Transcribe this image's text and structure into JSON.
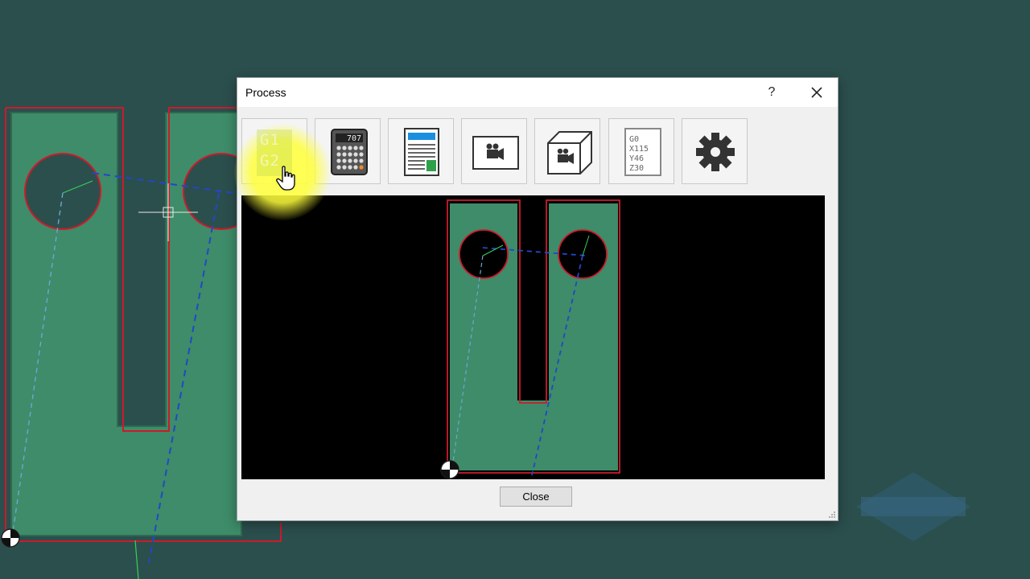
{
  "dialog": {
    "title": "Process",
    "help_label": "?",
    "close_button_label": "Close"
  },
  "toolbar": {
    "g1g2": {
      "line1": "G1",
      "line2": "G2",
      "icon": "g1-g2-icon"
    },
    "calculator": {
      "display": "707",
      "icon": "calculator-icon"
    },
    "report": {
      "icon": "document-report-icon"
    },
    "simulate_2d": {
      "icon": "video-camera-icon"
    },
    "simulate_3d": {
      "icon": "3d-box-camera-icon"
    },
    "gcode": {
      "lines": [
        "G0",
        "X115",
        "Y46",
        "Z30"
      ],
      "icon": "gcode-text-icon"
    },
    "settings": {
      "icon": "gear-icon"
    }
  },
  "colors": {
    "part_fill": "#3e8c69",
    "contour": "#cc1b2b",
    "toolpath": "#2247c9",
    "background": "#2b4f4d",
    "highlight": "#ffff46"
  }
}
